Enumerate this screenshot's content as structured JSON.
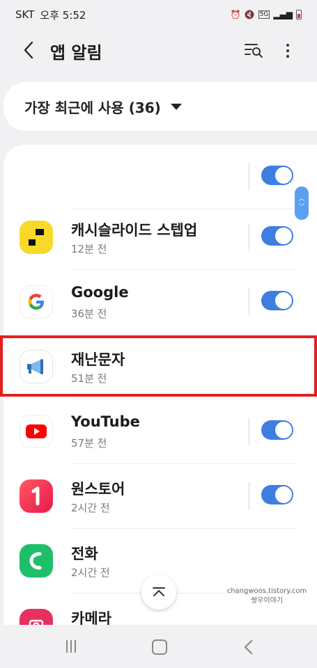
{
  "status_bar": {
    "carrier": "SKT",
    "time": "오후 5:52",
    "network_badge": "5G"
  },
  "app_bar": {
    "title": "앱 알림",
    "back_icon": "back-arrow-icon",
    "filter_icon": "search-filter-icon",
    "more_icon": "more-vert-icon"
  },
  "sort": {
    "label": "가장 최근에 사용 (36)"
  },
  "apps": [
    {
      "name": "",
      "time": "",
      "toggle": true,
      "hidden": true
    },
    {
      "name": "캐시슬라이드 스텝업",
      "time": "12분 전",
      "toggle": true
    },
    {
      "name": "Google",
      "time": "36분 전",
      "toggle": true
    },
    {
      "name": "재난문자",
      "time": "51분 전",
      "toggle": false
    },
    {
      "name": "YouTube",
      "time": "57분 전",
      "toggle": true
    },
    {
      "name": "원스토어",
      "time": "2시간 전",
      "toggle": true
    },
    {
      "name": "전화",
      "time": "2시간 전",
      "toggle": false
    },
    {
      "name": "카메라",
      "time": "",
      "toggle": false
    }
  ],
  "watermark": {
    "line1": "changwoos.tistory.com",
    "line2": "쌍우이야기"
  },
  "colors": {
    "toggle_on": "#3e7ee0",
    "highlight": "#e51f1f",
    "background": "#f1f1f3"
  }
}
